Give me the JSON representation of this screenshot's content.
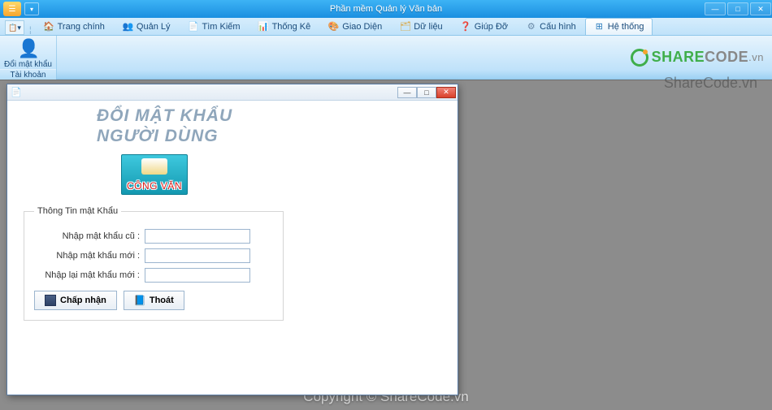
{
  "app": {
    "title": "Phần mềm Quản lý Văn bản"
  },
  "tabs": [
    {
      "icon": "🏠",
      "label": "Trang chính",
      "color": "#d97b2e"
    },
    {
      "icon": "👥",
      "label": "Quản Lý",
      "color": "#3a78c4"
    },
    {
      "icon": "📄",
      "label": "Tìm Kiếm",
      "color": "#e2b53a"
    },
    {
      "icon": "📊",
      "label": "Thống Kê",
      "color": "#3a9bd9"
    },
    {
      "icon": "🎨",
      "label": "Giao Diện",
      "color": "#e07c3a"
    },
    {
      "icon": "🗂",
      "label": "Dữ liệu",
      "color": "#d9a43a"
    },
    {
      "icon": "❓",
      "label": "Giúp Đỡ",
      "color": "#4aa7d9"
    },
    {
      "icon": "⚙",
      "label": "Cấu hình",
      "color": "#6b8aa8"
    },
    {
      "icon": "⊞",
      "label": "Hệ thống",
      "color": "#2f7fbf",
      "active": true
    }
  ],
  "ribbon": {
    "group_label": "Đổi mật khẩu",
    "group_category": "Tài khoản"
  },
  "branding": {
    "part1": "SHARE",
    "part2": "CODE",
    "part3": ".vn"
  },
  "watermark_top": "ShareCode.vn",
  "watermark_bottom": "Copyright © ShareCode.vn",
  "dialog": {
    "heading_line1": "ĐỔI MẬT KHẨU",
    "heading_line2": "NGƯỜI DÙNG",
    "badge_text": "CÔNG VĂN",
    "fieldset_legend": "Thông Tin mật Khẩu",
    "field_old": "Nhập mật khẩu cũ :",
    "field_new": "Nhập mật khẩu mới :",
    "field_repeat": "Nhập lại mật khẩu mới :",
    "btn_accept": "Chấp nhận",
    "btn_exit": "Thoát"
  }
}
